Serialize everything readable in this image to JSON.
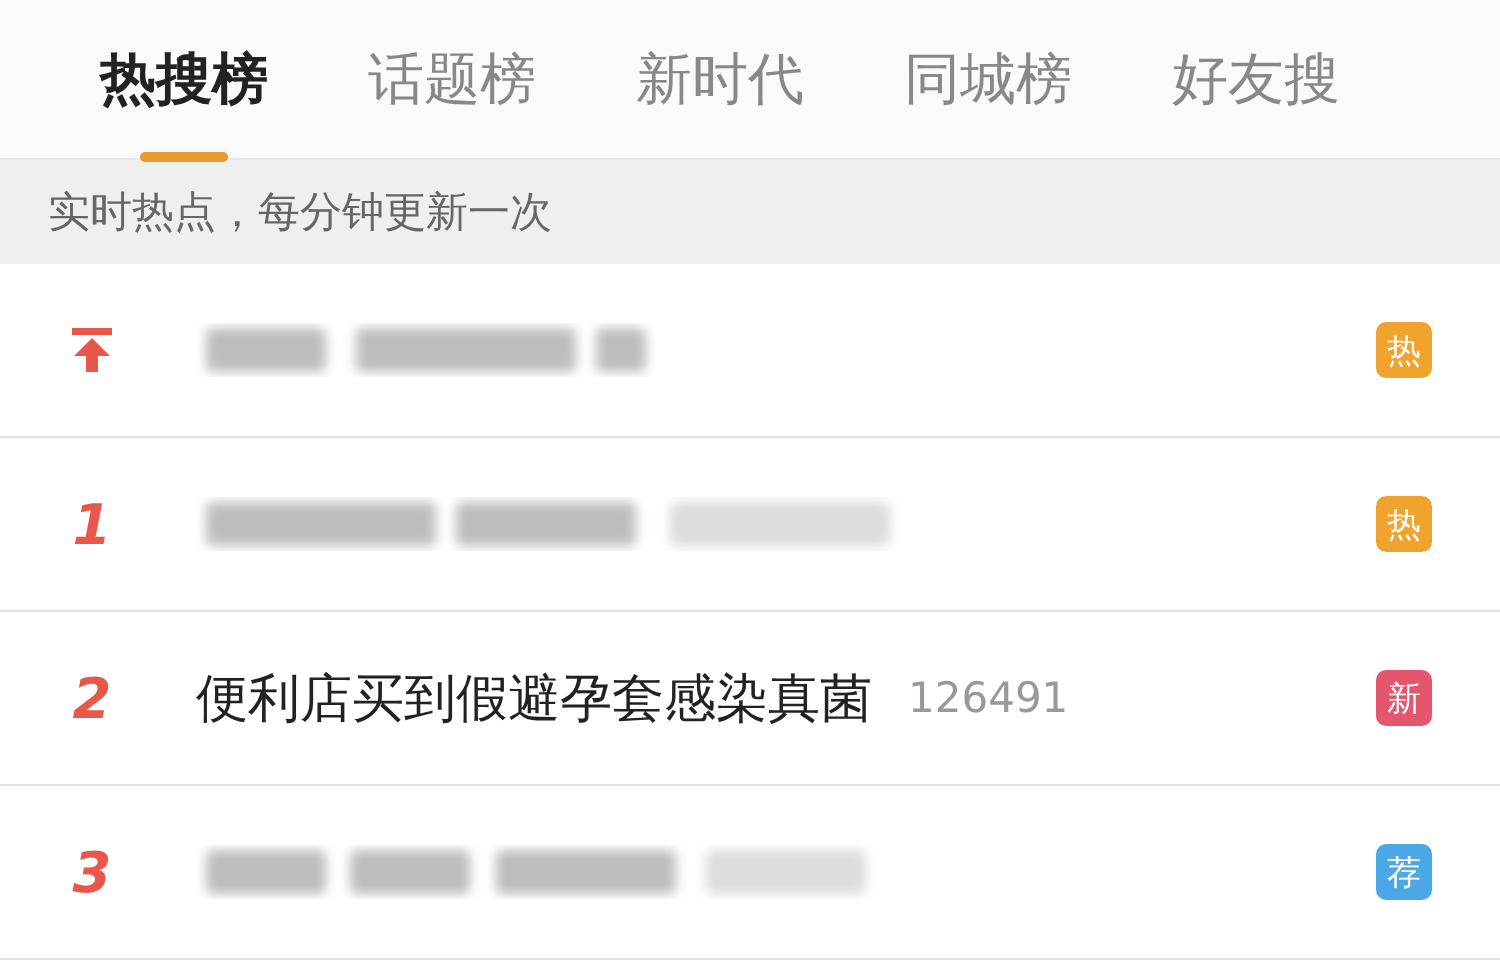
{
  "tabs": [
    {
      "label": "热搜榜",
      "selected": true
    },
    {
      "label": "话题榜",
      "selected": false
    },
    {
      "label": "新时代",
      "selected": false
    },
    {
      "label": "同城榜",
      "selected": false
    },
    {
      "label": "好友搜",
      "selected": false
    }
  ],
  "notice": "实时热点，每分钟更新一次",
  "rows": [
    {
      "pinned": true,
      "kind": "redacted",
      "badge": {
        "label": "热",
        "color": "#f0a42e"
      }
    },
    {
      "pinned": false,
      "rank": "1",
      "kind": "redacted",
      "badge": {
        "label": "热",
        "color": "#f0a42e"
      }
    },
    {
      "pinned": false,
      "rank": "2",
      "kind": "text",
      "title": "便利店买到假避孕套感染真菌",
      "count": "126491",
      "badge": {
        "label": "新",
        "color": "#e4566e"
      }
    },
    {
      "pinned": false,
      "rank": "3",
      "kind": "redacted",
      "badge": {
        "label": "荐",
        "color": "#4aa8e8"
      }
    }
  ]
}
